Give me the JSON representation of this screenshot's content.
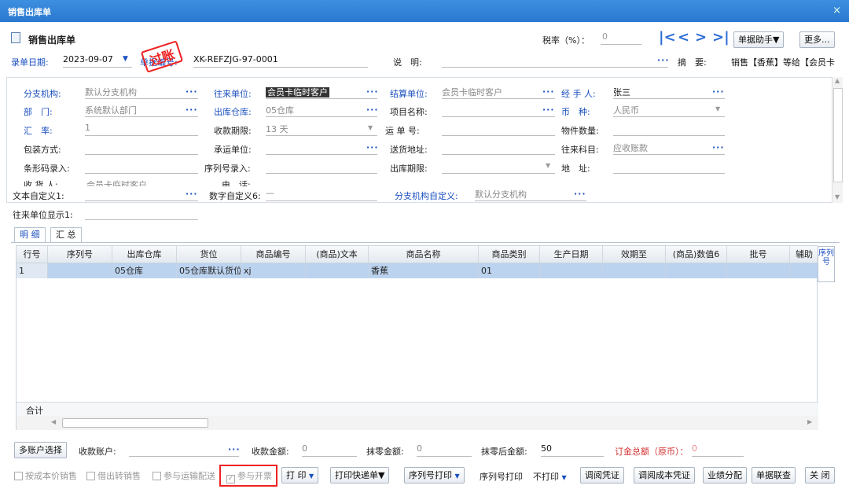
{
  "window": {
    "title": "销售出库单",
    "close": "×"
  },
  "header": {
    "title": "销售出库单",
    "tax_label": "税率（%）：",
    "tax_value": "0",
    "helper": "单据助手▼",
    "more": "更多..."
  },
  "meta": {
    "date_label": "录单日期:",
    "date_value": "2023-09-07",
    "no_label": "单据编号:",
    "no_value": "XK-REFZJG-97-0001",
    "stamp": "过账",
    "desc_label": "说　明:",
    "summary_label": "摘　要:",
    "summary_value": "销售【香蕉】等给【会员卡"
  },
  "form": {
    "branch_label": "分支机构:",
    "branch_value": "默认分支机构",
    "partner_label": "往来单位:",
    "partner_value": "会员卡临时客户",
    "settle_label": "结算单位:",
    "settle_value": "会员卡临时客户",
    "handler_label": "经 手 人:",
    "handler_value": "张三",
    "dept_label": "部　门:",
    "dept_value": "系统默认部门",
    "warehouse_label": "出库仓库:",
    "warehouse_value": "05仓库",
    "project_label": "项目名称:",
    "currency_label": "币　种:",
    "currency_value": "人民币",
    "rate_label": "汇　率:",
    "rate_value": "1",
    "term_label": "收款期限:",
    "term_value": "13 天",
    "waybill_label": "运 单 号:",
    "pieces_label": "物件数量:",
    "pack_label": "包装方式:",
    "carrier_label": "承运单位:",
    "address_label": "送货地址:",
    "account_label": "往来科目:",
    "account_value": "应收账款",
    "barcode_label": "条形码录入:",
    "serial_label": "序列号录入:",
    "outterm_label": "出库期限:",
    "addr_label": "地　址:",
    "receiver_label": "收 货 人:",
    "receiver_value": "会员卡临时客户",
    "phone_label": "电　话:",
    "textdef_label": "文本自定义1:",
    "numdef_label": "数字自定义6:",
    "numdef_value": "—",
    "branchdef_label": "分支机构自定义:",
    "branchdef_value": "默认分支机构",
    "partnerdisp_label": "往来单位显示1:"
  },
  "tabs": [
    "明 细",
    "汇 总"
  ],
  "grid": {
    "columns": [
      "行号",
      "序列号",
      "出库仓库",
      "货位",
      "商品编号",
      "(商品)文本",
      "商品名称",
      "商品类别",
      "生产日期",
      "效期至",
      "(商品)数值6",
      "批号",
      "辅助"
    ],
    "rows": [
      {
        "no": "1",
        "serial": "",
        "warehouse": "05仓库",
        "location": "05仓库默认货位",
        "code": "xj",
        "text": "",
        "name": "香蕉",
        "category": "01",
        "prod": "",
        "exp": "",
        "num": "",
        "batch": "",
        "aux": ""
      }
    ],
    "sum_label": "合计",
    "side_button": "序列号"
  },
  "footer": {
    "multi_account": "多账户选择",
    "account_label": "收款账户:",
    "amount_label": "收款金额:",
    "amount_value": "0",
    "zero_label": "抹零金额:",
    "zero_value": "0",
    "after_label": "抹零后金额:",
    "after_value": "50",
    "total_label": "订金总额（原币）：",
    "total_value": "0"
  },
  "options": {
    "cost_sale": "按成本价销售",
    "borrow": "借出转销售",
    "transport": "参与运输配送",
    "invoice": "参与开票"
  },
  "actions": {
    "print": "打 印",
    "express": "打印快递单▼",
    "serial_print": "序列号打印",
    "serial_print2": "序列号打印",
    "no_print": "不打印",
    "voucher": "调阅凭证",
    "cost_voucher": "调阅成本凭证",
    "perf": "业绩分配",
    "joint": "单据联查",
    "close": "关 闭"
  }
}
